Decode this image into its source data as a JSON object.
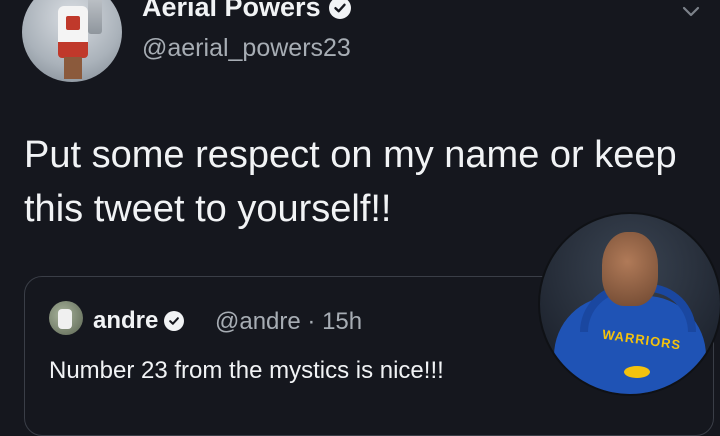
{
  "tweet": {
    "author_name": "Aerial Powers",
    "author_handle": "@aerial_powers23",
    "text_line1": "Put some respect on my name or keep",
    "text_line2": "this tweet to yourself!!",
    "quoted": {
      "name": "andre",
      "handle_time": "@andre · 15h",
      "text": "Number 23 from the mystics is nice!!!"
    }
  },
  "overlay": {
    "team_text": "WARRIORS"
  },
  "icons": {
    "verified": "verified-badge-icon",
    "caret": "chevron-down-icon"
  },
  "colors": {
    "background": "#15171e",
    "text": "#f1f3f5",
    "muted": "#a7adb4",
    "card_border": "#3a3e47",
    "warriors_blue": "#1f53b5",
    "warriors_gold": "#f4c20d"
  }
}
